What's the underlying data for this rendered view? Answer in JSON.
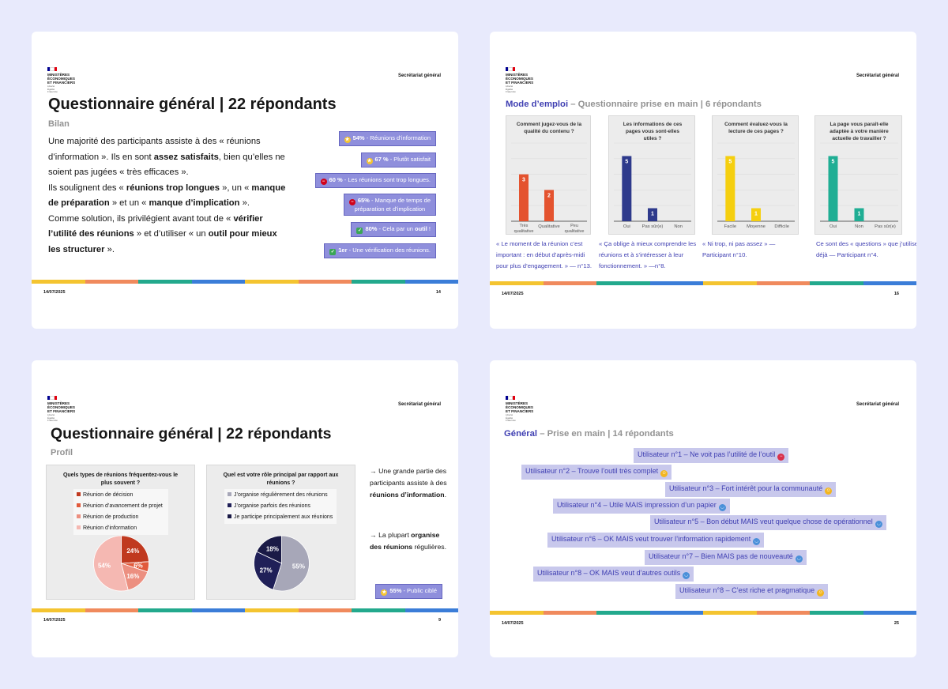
{
  "logo": {
    "line1": "MINISTÈRES\nÉCONOMIQUES\nET FINANCIERS",
    "line2": "Liberté\nÉgalité\nFraternité"
  },
  "header_right": "Secrétariat général",
  "stripe_colors": [
    "#f4c430",
    "#f08a5d",
    "#23a98d",
    "#3b7dd8",
    "#f4c430",
    "#f08a5d",
    "#23a98d",
    "#3b7dd8"
  ],
  "slides": [
    {
      "id": "s1",
      "date": "14/07/2025",
      "page": "14",
      "title": "Questionnaire général | 22 répondants",
      "subtitle": "Bilan",
      "body": [
        [
          {
            "t": "Une majorité des participants assiste à des « réunions d’information ». Ils en sont "
          },
          {
            "t": "assez satisfaits",
            "b": true
          },
          {
            "t": ", bien qu’elles ne soient pas jugées « très efficaces »."
          }
        ],
        [
          {
            "t": "Ils soulignent des « "
          },
          {
            "t": "réunions trop longues",
            "b": true
          },
          {
            "t": " », un « "
          },
          {
            "t": "manque de préparation",
            "b": true
          },
          {
            "t": " » et un « "
          },
          {
            "t": "manque d’implication",
            "b": true
          },
          {
            "t": " »."
          }
        ],
        [
          {
            "t": "Comme solution, ils privilégient avant tout de « "
          },
          {
            "t": "vérifier l’utilité des réunions",
            "b": true
          },
          {
            "t": " » et d’utiliser « un "
          },
          {
            "t": "outil pour mieux les structurer",
            "b": true
          },
          {
            "t": " »."
          }
        ]
      ],
      "badges": [
        {
          "icon": "star",
          "strong": "54%",
          "text": " - Réunions d’information"
        },
        {
          "icon": "star",
          "strong": "67 %",
          "text": " - Plutôt satisfait"
        },
        {
          "icon": "stop",
          "strong": "60 %",
          "text": " - Les réunions sont trop longues."
        },
        {
          "icon": "stop",
          "strong": "65%",
          "text": " - Manque de temps de",
          "line2": "préparation et d’implication"
        },
        {
          "icon": "check",
          "strong": "80%",
          "text": " - Cela par un ",
          "strong2": "outil",
          "text2": " !"
        },
        {
          "icon": "check",
          "strong": "1er",
          "text": " - Une vérification des réunions."
        }
      ]
    },
    {
      "id": "s2",
      "date": "14/07/2025",
      "page": "16",
      "accent": "Mode d’emploi",
      "subtitle_rest": " – Questionnaire prise en main | 6 répondants"
    },
    {
      "id": "s3",
      "date": "14/07/2025",
      "page": "9",
      "title": "Questionnaire général | 22 répondants",
      "subtitle": "Profil",
      "side": [
        [
          {
            "t": "→ Une grande partie des participants assiste à des "
          },
          {
            "t": "réunions d’information",
            "b": true
          },
          {
            "t": "."
          }
        ],
        [
          {
            "t": "→ La plupart "
          },
          {
            "t": "organise des réunions",
            "b": true
          },
          {
            "t": " régulières."
          }
        ]
      ],
      "badge": {
        "icon": "star",
        "strong": "55%",
        "text": " - Public ciblé"
      }
    },
    {
      "id": "s4",
      "date": "14/07/2025",
      "page": "25",
      "accent": "Général",
      "subtitle_rest": " – Prise en main | 14 répondants",
      "users": [
        {
          "label": "Utilisateur n°1 – ",
          "text": "Ne voit pas l’utilité de l’outil",
          "em": "red"
        },
        {
          "label": "Utilisateur n°2 – ",
          "text": "Trouve l’outil très complet",
          "em": "yellow"
        },
        {
          "label": "Utilisateur n°3 – ",
          "text": "Fort intérêt pour la communauté",
          "em": "yellow"
        },
        {
          "label": "Utilisateur n°4 – ",
          "text": "Utile MAIS impression d’un papier",
          "em": "blue"
        },
        {
          "label": "Utilisateur n°5 – ",
          "text": "Bon début MAIS veut quelque chose de opérationnel",
          "em": "blue"
        },
        {
          "label": "Utilisateur n°6 – ",
          "text": "OK MAIS veut trouver l’information rapidement",
          "em": "blue"
        },
        {
          "label": "Utilisateur n°7 – ",
          "text": "Bien MAIS pas de nouveauté",
          "em": "blue"
        },
        {
          "label": "Utilisateur n°8 – ",
          "text": "OK MAIS veut d’autres outils",
          "em": "blue"
        },
        {
          "label": "Utilisateur n°8 – ",
          "text": "C’est riche et pragmatique",
          "em": "yellow"
        }
      ]
    }
  ],
  "chart_data": [
    {
      "type": "bar",
      "title": "Comment jugez-vous de la qualité du contenu ?",
      "categories": [
        "Très qualitative",
        "Qualitative",
        "Peu qualitative"
      ],
      "values": [
        3,
        2,
        0
      ],
      "color": "#e4532f",
      "ylim": [
        0,
        5
      ],
      "quote": "« Le moment de la réunion c’est important : en début d’après-midi pour plus d’engagement. » — n°13."
    },
    {
      "type": "bar",
      "title": "Les informations de ces pages vous sont-elles utiles ?",
      "categories": [
        "Oui",
        "Pas sûr(e)",
        "Non"
      ],
      "values": [
        5,
        1,
        0
      ],
      "color": "#2e3a8c",
      "ylim": [
        0,
        6
      ],
      "quote": "« Ça oblige à mieux comprendre les réunions et à s’intéresser à leur fonctionnement. » —n°8."
    },
    {
      "type": "bar",
      "title": "Comment évaluez-vous la lecture de ces pages ?",
      "categories": [
        "Facile",
        "Moyenne",
        "Difficile"
      ],
      "values": [
        5,
        1,
        0
      ],
      "color": "#f5cf0f",
      "ylim": [
        0,
        6
      ],
      "quote": "« Ni trop, ni pas assez » — Participant n°10."
    },
    {
      "type": "bar",
      "title": "La page vous paraît-elle adaptée à votre manière actuelle de travailler ?",
      "categories": [
        "Oui",
        "Non",
        "Pas sûr(e)"
      ],
      "values": [
        5,
        1,
        0
      ],
      "color": "#1fae94",
      "ylim": [
        0,
        6
      ],
      "quote": "Ce sont des « questions » que j’utilise déjà — Participant n°4."
    },
    {
      "type": "pie",
      "title": "Quels types de réunions fréquentez-vous le plus souvent ?",
      "labels": [
        "Réunion de décision",
        "Réunion d’avancement de projet",
        "Réunion de production",
        "Réunion d’information"
      ],
      "values": [
        24,
        6,
        16,
        54
      ],
      "colors": [
        "#c0391f",
        "#e15a3c",
        "#ec8f80",
        "#f5b8b2"
      ]
    },
    {
      "type": "pie",
      "title": "Quel est votre rôle principal par rapport aux réunions ?",
      "labels": [
        "J’organise régulièrement des réunions",
        "J’organise parfois des réunions",
        "Je participe principalement aux réunions"
      ],
      "values": [
        55,
        27,
        18
      ],
      "colors": [
        "#a7a7b8",
        "#202058",
        "#1a1a46"
      ]
    }
  ]
}
